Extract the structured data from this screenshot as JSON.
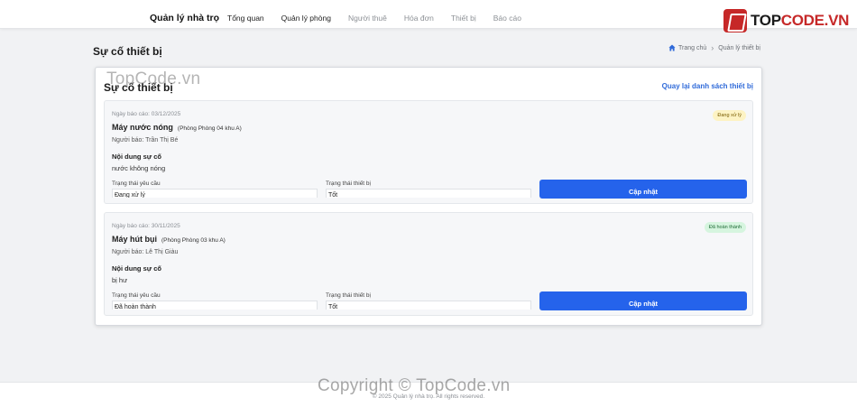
{
  "header": {
    "brand": "Quản lý nhà trọ",
    "nav": [
      {
        "label": "Tổng quan"
      },
      {
        "label": "Quản lý phòng"
      },
      {
        "label": "Người thuê"
      },
      {
        "label": "Hóa đơn"
      },
      {
        "label": "Thiết bị"
      },
      {
        "label": "Báo cáo"
      }
    ],
    "logo": {
      "prefix": "TOP",
      "suffix": "CODE.VN"
    }
  },
  "page": {
    "title": "Sự cố thiết bị",
    "breadcrumb": {
      "home": "Trang chủ",
      "current": "Quản lý thiết bị"
    }
  },
  "panel": {
    "title": "Sự cố thiết bị",
    "back_link": "Quay lại danh sách thiết bị",
    "field_labels": {
      "request_status": "Trạng thái yêu cầu",
      "device_status": "Trạng thái thiết bị"
    },
    "update_label": "Cập nhật",
    "content_label": "Nội dung sự cố",
    "incidents": [
      {
        "date": "Ngày báo cáo: 03/12/2025",
        "device": "Máy nước nóng",
        "room": "(Phòng Phòng 04 khu A)",
        "reporter": "Người báo: Trần Thị Bé",
        "content": "nước không nóng",
        "badge": "Đang xử lý",
        "request_status": "Đang xử lý",
        "device_status": "Tốt"
      },
      {
        "date": "Ngày báo cáo: 30/11/2025",
        "device": "Máy hút bụi",
        "room": "(Phòng Phòng 03 khu A)",
        "reporter": "Người báo: Lê Thị Giàu",
        "content": "bị hư",
        "badge": "Đã hoàn thành",
        "request_status": "Đã hoàn thành",
        "device_status": "Tốt"
      }
    ]
  },
  "footer": {
    "text": "© 2025 Quản lý nhà trọ. All rights reserved."
  },
  "watermarks": {
    "top": "TopCode.vn",
    "bottom": "Copyright © TopCode.vn"
  },
  "colors": {
    "accent": "#2563eb",
    "link": "#2f6ad9",
    "logo_red": "#c62828"
  }
}
